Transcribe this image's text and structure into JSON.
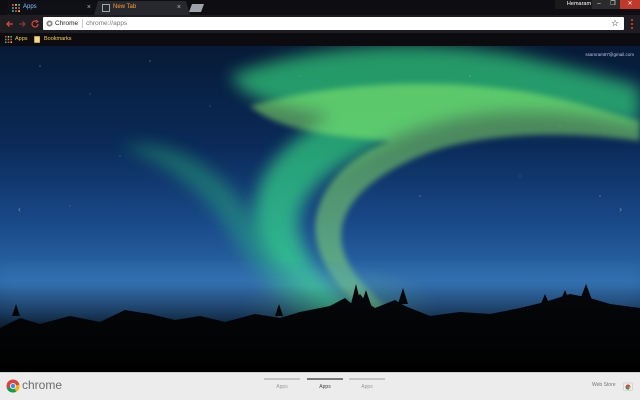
{
  "window": {
    "profile_name": "Hemaram",
    "controls": {
      "minimize": "–",
      "maximize": "❐",
      "close": "✕"
    }
  },
  "tabs": [
    {
      "label": "Apps",
      "icon": "apps-grid-icon",
      "active": true,
      "close": "×"
    },
    {
      "label": "New Tab",
      "icon": "new-tab-page-icon",
      "active": false,
      "close": "×"
    }
  ],
  "toolbar": {
    "site_label": "Chrome",
    "url": "chrome://apps",
    "star": "☆"
  },
  "bookmarks_bar": {
    "items": [
      {
        "label": "Apps",
        "icon": "apps-grid-icon"
      },
      {
        "label": "Bookmarks",
        "icon": "folder-icon"
      }
    ]
  },
  "content": {
    "user_email": "ssamram87@gmail.com",
    "prev_arrow": "‹",
    "next_arrow": "›",
    "background": "aurora-borealis-night-sky"
  },
  "bottom_bar": {
    "wordmark": "chrome",
    "page_tabs": [
      {
        "label": "Apps",
        "active": false
      },
      {
        "label": "Apps",
        "active": true
      },
      {
        "label": "Apps",
        "active": false
      }
    ],
    "web_store_label": "Web Store"
  },
  "colors": {
    "active_tab_text": "#7ec8ff",
    "inactive_tab_text": "#ff9f2e",
    "bookmark_text": "#ffd24a",
    "close_button": "#c0392b"
  }
}
